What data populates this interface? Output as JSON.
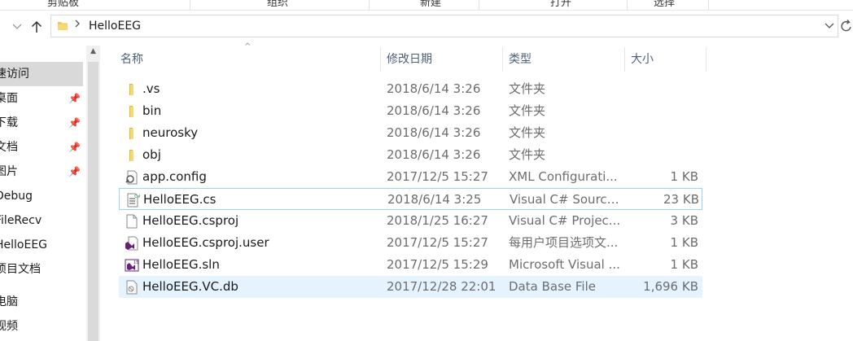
{
  "ribbon": {
    "labels": [
      "剪贴板",
      "组织",
      "新建",
      "打开",
      "选择"
    ]
  },
  "address": {
    "path": "HelloEEG"
  },
  "nav_pane": {
    "items": [
      {
        "label": "速访问",
        "pinned": false,
        "selected": true
      },
      {
        "label": "桌面",
        "pinned": true,
        "selected": false
      },
      {
        "label": "下载",
        "pinned": true,
        "selected": false
      },
      {
        "label": "文档",
        "pinned": true,
        "selected": false
      },
      {
        "label": "图片",
        "pinned": true,
        "selected": false
      },
      {
        "label": "Debug",
        "pinned": false,
        "selected": false
      },
      {
        "label": "FileRecv",
        "pinned": false,
        "selected": false
      },
      {
        "label": "HelloEEG",
        "pinned": false,
        "selected": false
      },
      {
        "label": "项目文档",
        "pinned": false,
        "selected": false
      },
      {
        "label": "电脑",
        "pinned": false,
        "selected": false
      },
      {
        "label": "视频",
        "pinned": false,
        "selected": false
      }
    ]
  },
  "columns": {
    "name": "名称",
    "date": "修改日期",
    "type": "类型",
    "size": "大小"
  },
  "files": [
    {
      "name": ".vs",
      "date": "2018/6/14 3:26",
      "type": "文件夹",
      "size": "",
      "icon": "folder-icon"
    },
    {
      "name": "bin",
      "date": "2018/6/14 3:26",
      "type": "文件夹",
      "size": "",
      "icon": "folder-icon"
    },
    {
      "name": "neurosky",
      "date": "2018/6/14 3:26",
      "type": "文件夹",
      "size": "",
      "icon": "folder-icon"
    },
    {
      "name": "obj",
      "date": "2018/6/14 3:26",
      "type": "文件夹",
      "size": "",
      "icon": "folder-icon"
    },
    {
      "name": "app.config",
      "date": "2017/12/5 15:27",
      "type": "XML Configurati...",
      "size": "1 KB",
      "icon": "config-file-icon"
    },
    {
      "name": "HelloEEG.cs",
      "date": "2018/6/14 3:25",
      "type": "Visual C# Source...",
      "size": "23 KB",
      "icon": "csharp-file-icon"
    },
    {
      "name": "HelloEEG.csproj",
      "date": "2018/1/25 16:27",
      "type": "Visual C# Projec...",
      "size": "3 KB",
      "icon": "blank-file-icon"
    },
    {
      "name": "HelloEEG.csproj.user",
      "date": "2017/12/5 15:27",
      "type": "每用户项目选项文...",
      "size": "1 KB",
      "icon": "visual-studio-file-icon"
    },
    {
      "name": "HelloEEG.sln",
      "date": "2017/12/5 15:29",
      "type": "Microsoft Visual ...",
      "size": "1 KB",
      "icon": "solution-file-icon"
    },
    {
      "name": "HelloEEG.VC.db",
      "date": "2017/12/28 22:01",
      "type": "Data Base File",
      "size": "1,696 KB",
      "icon": "database-file-icon"
    }
  ]
}
